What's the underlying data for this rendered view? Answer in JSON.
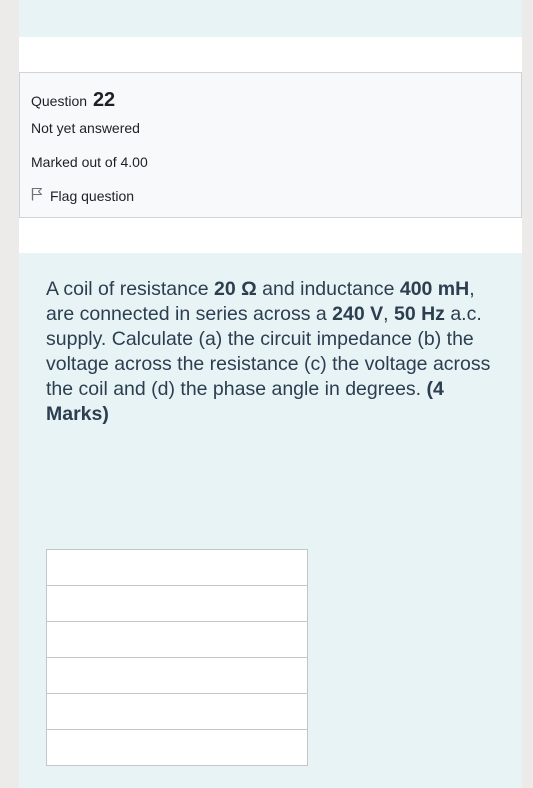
{
  "question": {
    "label": "Question",
    "number": "22",
    "status": "Not yet answered",
    "marks": "Marked out of 4.00",
    "flag_label": "Flag question"
  },
  "text": {
    "p1": "A coil of resistance ",
    "resistance": "20 Ω",
    "p2": " and inductance ",
    "inductance": "400 mH",
    "p3": ", are connected in series across a ",
    "voltage": "240 V",
    "p4": ", ",
    "frequency": "50 Hz",
    "p5": " a.c. supply. Calculate (a) the circuit impedance (b) the voltage across the resistance (c) the voltage across the coil and (d) the phase angle in degrees. ",
    "marks": "(4 Marks)"
  },
  "answer_lines": [
    "",
    "",
    "",
    "",
    "",
    ""
  ],
  "colors": {
    "background": "#ecebe9",
    "content": "#e7f3f5",
    "info_box": "#f8f9fa",
    "text": "#2c3e50"
  }
}
